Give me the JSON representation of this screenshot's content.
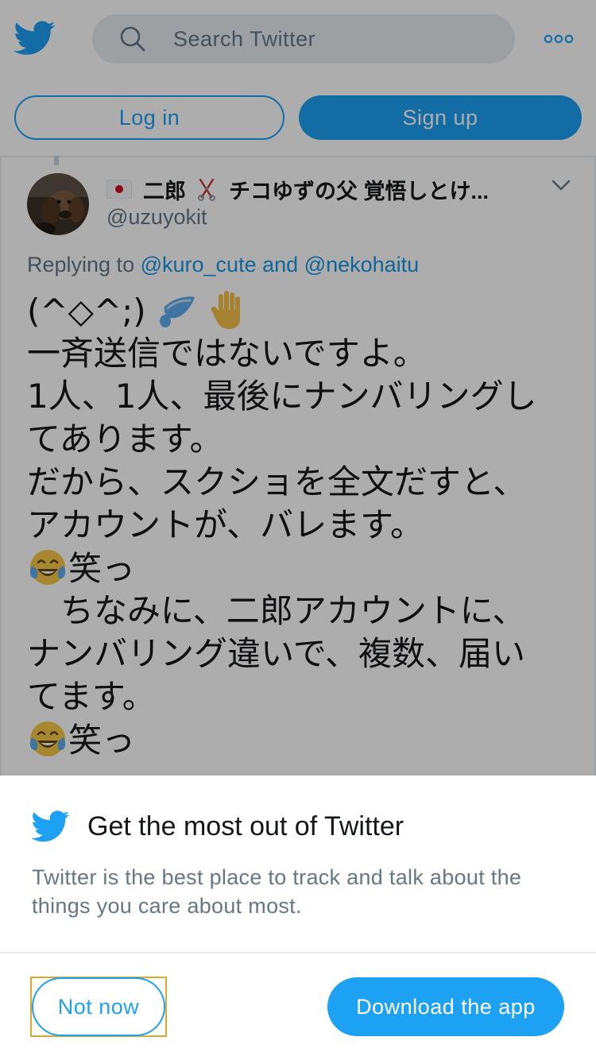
{
  "header": {
    "search_placeholder": "Search Twitter",
    "login_label": "Log in",
    "signup_label": "Sign up"
  },
  "tweet": {
    "display_name_part1": "二郎",
    "display_name_part2": "チコゆずの父 覚悟しとけ...",
    "handle": "@uzuyokit",
    "replying_prefix": "Replying to",
    "reply_user_1": "@kuro_cute",
    "reply_and": "and",
    "reply_user_2": "@nekohaitu",
    "lines": [
      "(^◇^;)",
      "一斉送信ではないですよ。",
      "1人、1人、最後にナンバリングし",
      "てあります。",
      "だから、スクショを全文だすと、",
      "アカウントが、バレます。",
      "笑っ",
      "　ちなみに、二郎アカウントに、",
      "ナンバリング違いで、複数、届い",
      "てます。",
      "笑っ"
    ]
  },
  "prompt": {
    "title": "Get the most out of Twitter",
    "description": "Twitter is the best place to track and talk about the things you care about most.",
    "not_now_label": "Not now",
    "download_label": "Download the app"
  },
  "colors": {
    "brand_blue": "#1da1f2",
    "link_blue": "#1b95e0",
    "secondary_text": "#657786",
    "focus_outline": "#e0a62b"
  },
  "icons": [
    "twitter-bird-icon",
    "search-icon",
    "more-icon",
    "flag-jp-icon",
    "scissors-icon",
    "chevron-down-icon",
    "sweat-drops-icon",
    "raised-hand-icon",
    "tears-of-joy-icon"
  ]
}
